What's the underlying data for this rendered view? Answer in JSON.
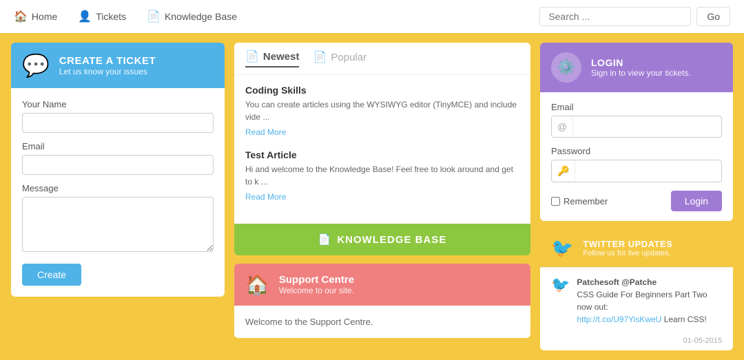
{
  "nav": {
    "home_label": "Home",
    "tickets_label": "Tickets",
    "kb_label": "Knowledge Base",
    "search_placeholder": "Search ...",
    "search_btn": "Go"
  },
  "create_ticket": {
    "header_title": "CREATE A TICKET",
    "header_sub": "Let us know your issues",
    "name_label": "Your Name",
    "email_label": "Email",
    "message_label": "Message",
    "button_label": "Create"
  },
  "kb_section": {
    "tab_newest": "Newest",
    "tab_popular": "Popular",
    "articles": [
      {
        "title": "Coding Skills",
        "excerpt": "You can create articles using the WYSIWYG editor (TinyMCE) and include vide ...",
        "read_more": "Read More"
      },
      {
        "title": "Test Article",
        "excerpt": "Hi and welcome to the Knowledge Base! Feel free to look around and get to k ...",
        "read_more": "Read More"
      }
    ],
    "kb_btn_label": "KNOWLEDGE BASE"
  },
  "support": {
    "header_title": "Support Centre",
    "header_sub": "Welcome to our site.",
    "body_text": "Welcome to the Support Centre."
  },
  "login": {
    "header_title": "LOGIN",
    "header_sub": "Sign in to view your tickets.",
    "email_label": "Email",
    "email_icon": "@",
    "password_label": "Password",
    "password_icon": "🔑",
    "remember_label": "Remember",
    "login_btn": "Login"
  },
  "twitter": {
    "header_title": "TWITTER UPDATES",
    "header_sub": "Follow us for live updates.",
    "tweets": [
      {
        "user": "Patchesoft @Patche",
        "text": "CSS Guide For Beginners Part Two now out:",
        "link": "http://t.co/U97YisKweU",
        "link_text": "http://t.co/U97YisKweU",
        "suffix": " Learn CSS!",
        "date": "01-05-2015"
      }
    ]
  }
}
